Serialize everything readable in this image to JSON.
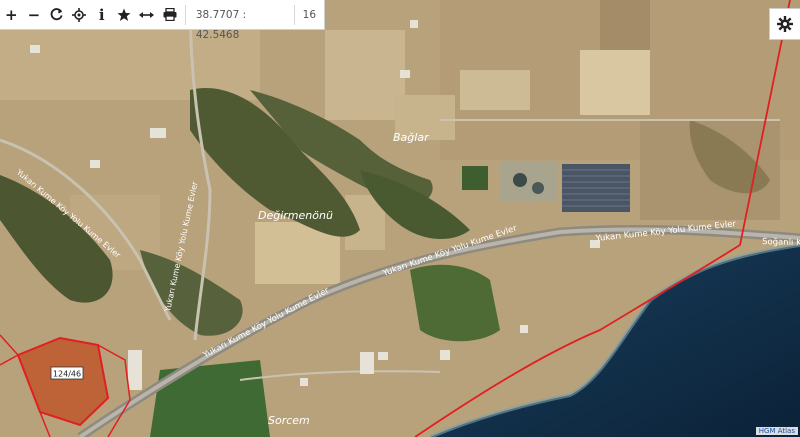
{
  "toolbar": {
    "zoom_in": "+",
    "zoom_out": "−",
    "info": "i",
    "coordinates": "38.7707 : 42.5468",
    "zoom_level": "16"
  },
  "icons": [
    "plus-icon",
    "minus-icon",
    "refresh-icon",
    "locate-icon",
    "info-icon",
    "star-icon",
    "measure-icon",
    "print-icon",
    "gear-icon"
  ],
  "map": {
    "place_labels": {
      "baglar": "Bağlar",
      "degirmenonu": "Değirmenönü",
      "sorcem": "Sorcem"
    },
    "road_labels": {
      "road_bottom": "Yukarı Kume Köy Yolu Kume Evler",
      "road_middle": "Yukarı Kume Köy Yolu Kume Evler",
      "road_top": "Yukarı Kume Köy Yolu Kume Evler",
      "road_left_a": "Yukarı Kume Köy Yolu Kume Evler",
      "road_left_b": "Yukarı Kume Köy Yolu Kume Evler",
      "road_right": "Soğanlı Kume"
    },
    "parcel_label": "124/46",
    "colors": {
      "parcel_fill": "#c0542a",
      "boundary": "#e02020",
      "sea": "#0e2a44"
    }
  },
  "attribution": "HGM Atlas"
}
